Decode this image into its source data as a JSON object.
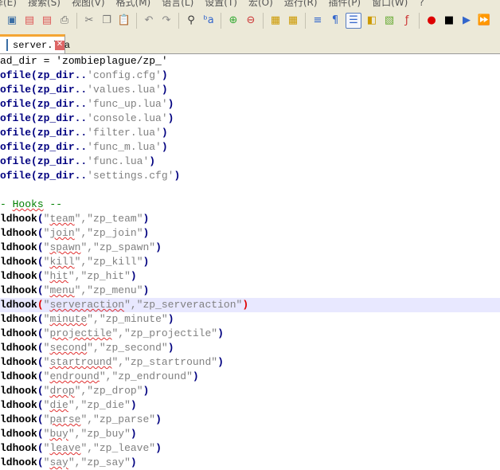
{
  "menu": [
    "译(E)",
    "搜索(S)",
    "视图(V)",
    "格式(M)",
    "语言(L)",
    "设置(T)",
    "宏(O)",
    "运行(R)",
    "插件(P)",
    "窗口(W)",
    "?"
  ],
  "tab": {
    "label": "server.lua",
    "close": "✕"
  },
  "code": {
    "line0": "ad_dir = 'zombieplague/zp_'",
    "dofile": [
      "'config.cfg'",
      "'values.lua'",
      "'func_up.lua'",
      "'console.lua'",
      "'filter.lua'",
      "'func_m.lua'",
      "'func.lua'",
      "'settings.cfg'"
    ],
    "dofile_prefix": "ofile",
    "dofile_arg": "(zp_dir..",
    "comment_dash": "- ",
    "comment_word": "Hooks",
    "comment_end": " --",
    "hook_fn": "ldhook",
    "hooks": [
      "team",
      "join",
      "spawn",
      "kill",
      "hit",
      "menu",
      "serveraction",
      "minute",
      "projectile",
      "second",
      "startround",
      "endround",
      "drop",
      "die",
      "parse",
      "buy",
      "leave",
      "say"
    ],
    "highlighted_hook": "serveraction"
  }
}
